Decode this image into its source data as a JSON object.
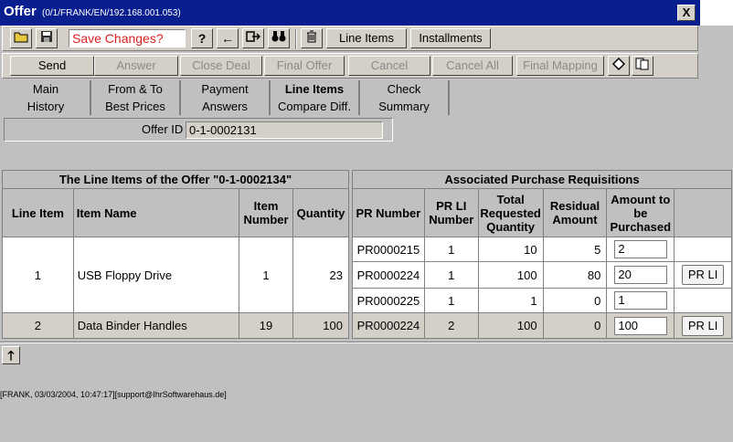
{
  "window": {
    "title": "Offer",
    "subtitle": "(0/1/FRANK/EN/192.168.001.053)",
    "close_label": "X"
  },
  "toolbar1": {
    "save_changes": "Save Changes?",
    "help_label": "?",
    "line_items": "Line Items",
    "installments": "Installments"
  },
  "toolbar2": {
    "send": "Send",
    "answer": "Answer",
    "close_deal": "Close Deal",
    "final_offer": "Final Offer",
    "cancel": "Cancel",
    "cancel_all": "Cancel All",
    "final_mapping": "Final Mapping"
  },
  "tabs": {
    "row1": [
      "Main",
      "From & To",
      "Payment",
      "Line Items",
      "Check"
    ],
    "row2": [
      "History",
      "Best Prices",
      "Answers",
      "Compare Diff.",
      "Summary"
    ]
  },
  "offer": {
    "id_label": "Offer ID",
    "id_value": "0-1-0002131"
  },
  "left_table": {
    "caption": "The Line Items of the  Offer \"0-1-0002134\"",
    "headers": [
      "Line Item",
      "Item Name",
      "Item Number",
      "Quantity"
    ],
    "rows": [
      {
        "line_item": "1",
        "item_name": "USB Floppy Drive",
        "item_number": "1",
        "quantity": "23"
      },
      {
        "line_item": "2",
        "item_name": "Data Binder Handles",
        "item_number": "19",
        "quantity": "100"
      }
    ]
  },
  "right_table": {
    "caption": "Associated Purchase Requisitions",
    "headers": [
      "PR Number",
      "PR LI Number",
      "Total Requested Quantity",
      "Residual Amount",
      "Amount to be Purchased",
      ""
    ],
    "rows": [
      {
        "pr_number": "PR0000215",
        "pr_li": "1",
        "total": "10",
        "residual": "5",
        "amount": "2"
      },
      {
        "pr_number": "PR0000224",
        "pr_li": "1",
        "total": "100",
        "residual": "80",
        "amount": "20",
        "button": "PR LI"
      },
      {
        "pr_number": "PR0000225",
        "pr_li": "1",
        "total": "1",
        "residual": "0",
        "amount": "1"
      },
      {
        "pr_number": "PR0000224",
        "pr_li": "2",
        "total": "100",
        "residual": "0",
        "amount": "100",
        "button": "PR LI"
      }
    ]
  },
  "status": {
    "text": "[FRANK, 03/03/2004, 10:47:17][support@IhrSoftwarehaus.de]"
  },
  "icons": {
    "open": "folder-icon",
    "save": "floppy-icon",
    "back": "arrow-left-icon",
    "exit": "exit-icon",
    "find": "binoculars-icon",
    "delete": "trash-icon",
    "diamond": "diamond-icon",
    "pages": "pages-icon",
    "up": "arrow-up-icon"
  }
}
